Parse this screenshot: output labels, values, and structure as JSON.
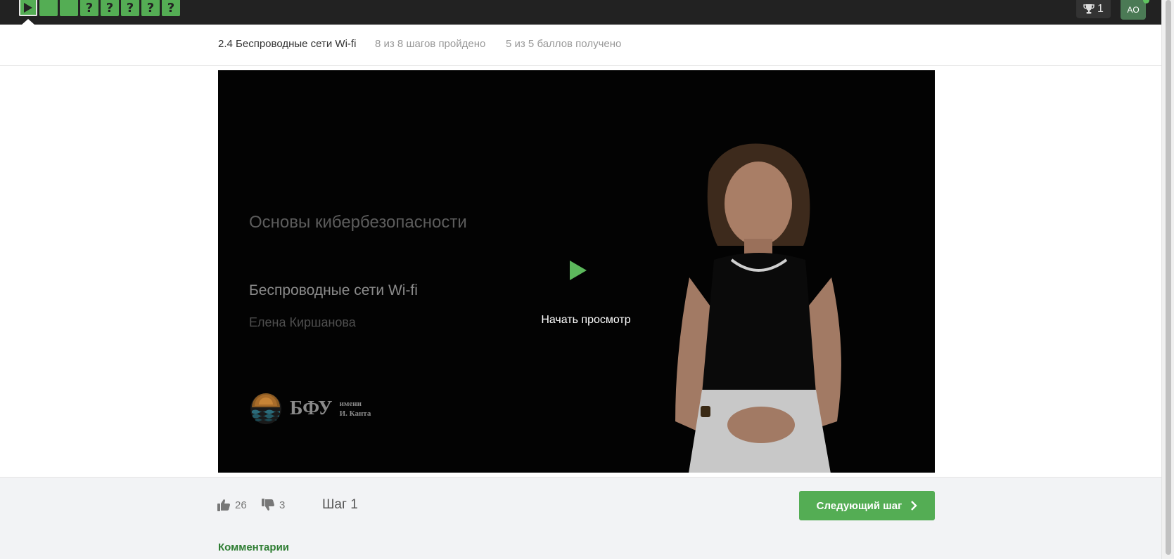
{
  "topbar": {
    "steps": [
      {
        "type": "video",
        "icon": "play-icon",
        "current": true
      },
      {
        "type": "completed",
        "label": ""
      },
      {
        "type": "completed",
        "label": ""
      },
      {
        "type": "quiz",
        "label": "?"
      },
      {
        "type": "quiz",
        "label": "?"
      },
      {
        "type": "quiz",
        "label": "?"
      },
      {
        "type": "quiz",
        "label": "?"
      },
      {
        "type": "quiz",
        "label": "?"
      }
    ],
    "notifications": {
      "icon": "trophy-icon",
      "count": "1"
    },
    "avatar": {
      "initials": "AO"
    }
  },
  "lesson": {
    "title": "2.4 Беспроводные сети Wi-fi",
    "steps_progress": "8 из 8 шагов пройдено",
    "points_progress": "5 из 5 баллов  получено"
  },
  "video": {
    "course_title": "Основы кибербезопасности",
    "topic": "Беспроводные сети Wi-fi",
    "author": "Елена Киршанова",
    "logo_text": "БФУ",
    "logo_sub_1": "имени",
    "logo_sub_2": "И. Канта",
    "start_label": "Начать просмотр"
  },
  "footer": {
    "likes": "26",
    "dislikes": "3",
    "step_label": "Шаг 1",
    "next_label": "Следующий шаг",
    "comments_label": "Комментарии"
  },
  "colors": {
    "accent": "#54ad54",
    "topbar": "#222222",
    "link": "#2e7d32"
  }
}
